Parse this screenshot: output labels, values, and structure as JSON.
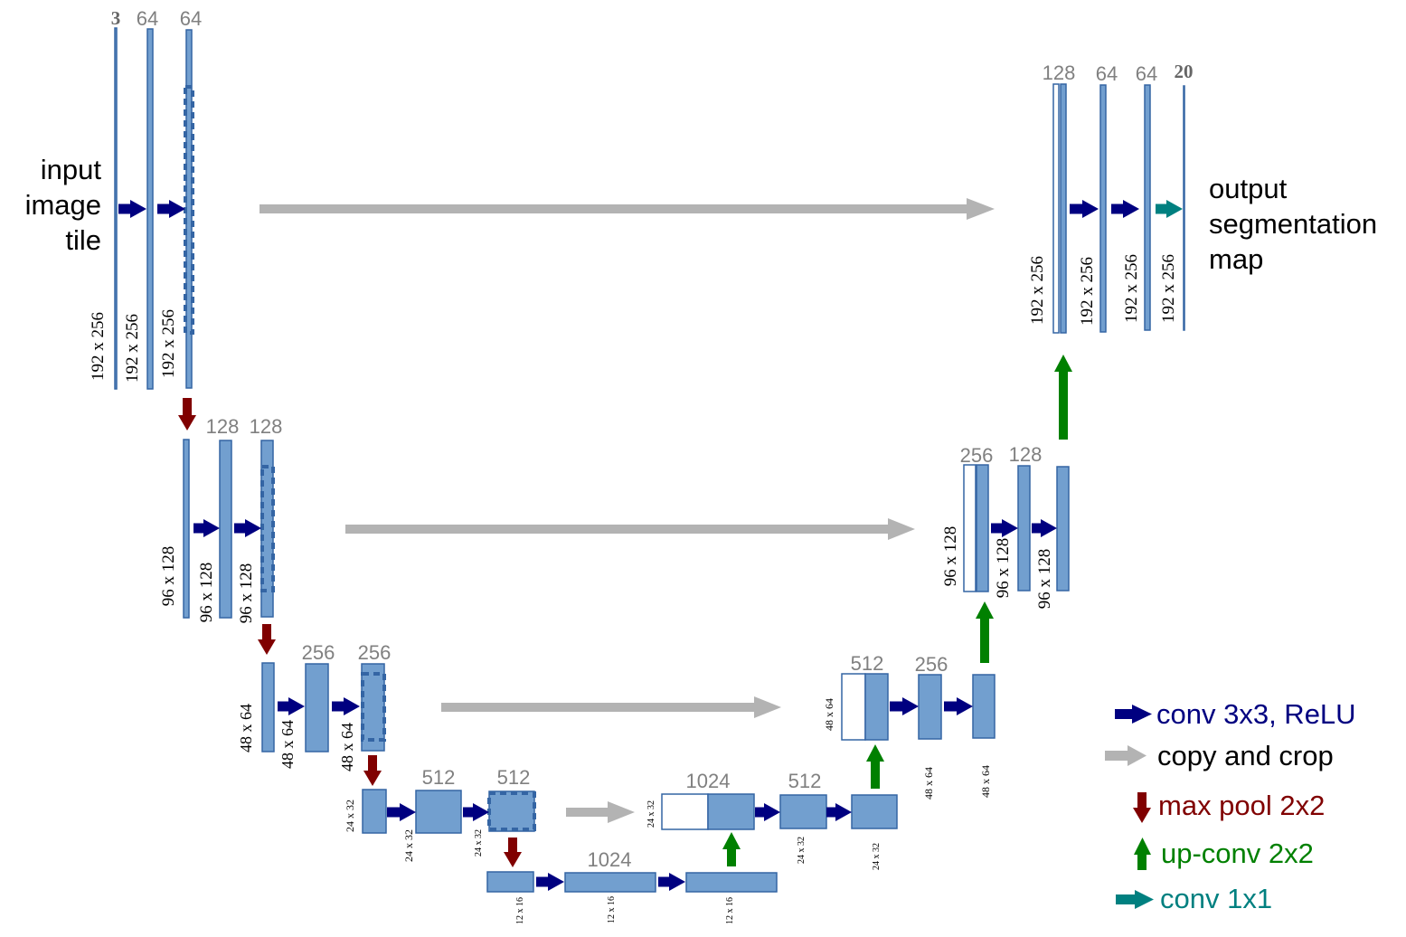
{
  "colors": {
    "feature_map_fill": "#729fcf",
    "feature_map_stroke": "#3465a4",
    "conv": "#000080",
    "copy": "#b3b3b3",
    "pool": "#800000",
    "upconv": "#008000",
    "conv1x1": "#008080",
    "channel_label": "#808080"
  },
  "labels": {
    "input": [
      "input",
      "image",
      "tile"
    ],
    "output": [
      "output",
      "segmentation",
      "map"
    ]
  },
  "legend": [
    {
      "icon": "conv-arrow-icon",
      "kind": "conv",
      "text": "conv 3x3, ReLU"
    },
    {
      "icon": "copy-arrow-icon",
      "kind": "copy",
      "text": "copy and crop"
    },
    {
      "icon": "maxpool-arrow-icon",
      "kind": "pool",
      "text": "max pool 2x2"
    },
    {
      "icon": "upconv-arrow-icon",
      "kind": "upconv",
      "text": "up-conv 2x2"
    },
    {
      "icon": "conv1x1-arrow-icon",
      "kind": "conv1x1",
      "text": "conv 1x1"
    }
  ],
  "feature_maps": [
    {
      "id": "enc1-input",
      "channels": "3",
      "size": "192 x 256",
      "bold": true
    },
    {
      "id": "enc1-conv1",
      "channels": "64",
      "size": "192 x 256"
    },
    {
      "id": "enc1-conv2",
      "channels": "64",
      "size": "192 x 256"
    },
    {
      "id": "enc2-pool",
      "channels": "",
      "size": "96 x 128"
    },
    {
      "id": "enc2-conv1",
      "channels": "128",
      "size": "96 x 128"
    },
    {
      "id": "enc2-conv2",
      "channels": "128",
      "size": "96 x 128"
    },
    {
      "id": "enc3-pool",
      "channels": "",
      "size": "48 x 64"
    },
    {
      "id": "enc3-conv1",
      "channels": "256",
      "size": "48 x 64"
    },
    {
      "id": "enc3-conv2",
      "channels": "256",
      "size": "48 x 64"
    },
    {
      "id": "enc4-pool",
      "channels": "",
      "size": "24 x 32"
    },
    {
      "id": "enc4-conv1",
      "channels": "512",
      "size": "24 x 32"
    },
    {
      "id": "enc4-conv2",
      "channels": "512",
      "size": "24 x 32"
    },
    {
      "id": "bott-pool",
      "channels": "",
      "size": "12 x 16"
    },
    {
      "id": "bott-conv1",
      "channels": "1024",
      "size": "12 x 16"
    },
    {
      "id": "bott-conv2",
      "channels": "",
      "size": "12 x 16"
    },
    {
      "id": "dec4-concat",
      "channels": "1024",
      "size": "24 x 32"
    },
    {
      "id": "dec4-conv1",
      "channels": "512",
      "size": "24 x 32"
    },
    {
      "id": "dec4-conv2",
      "channels": "",
      "size": "24 x 32"
    },
    {
      "id": "dec3-concat",
      "channels": "512",
      "size": "48 x 64"
    },
    {
      "id": "dec3-conv1",
      "channels": "256",
      "size": "48 x 64"
    },
    {
      "id": "dec3-conv2",
      "channels": "",
      "size": "48 x 64"
    },
    {
      "id": "dec2-concat",
      "channels": "256",
      "size": "96 x 128"
    },
    {
      "id": "dec2-conv1",
      "channels": "128",
      "size": "96 x 128"
    },
    {
      "id": "dec2-conv2",
      "channels": "",
      "size": "96 x 128"
    },
    {
      "id": "dec1-concat",
      "channels": "128",
      "size": "192 x 256"
    },
    {
      "id": "dec1-conv1",
      "channels": "64",
      "size": "192 x 256"
    },
    {
      "id": "dec1-conv2",
      "channels": "64",
      "size": "192 x 256"
    },
    {
      "id": "output",
      "channels": "20",
      "size": "192 x 256",
      "bold": true
    }
  ]
}
